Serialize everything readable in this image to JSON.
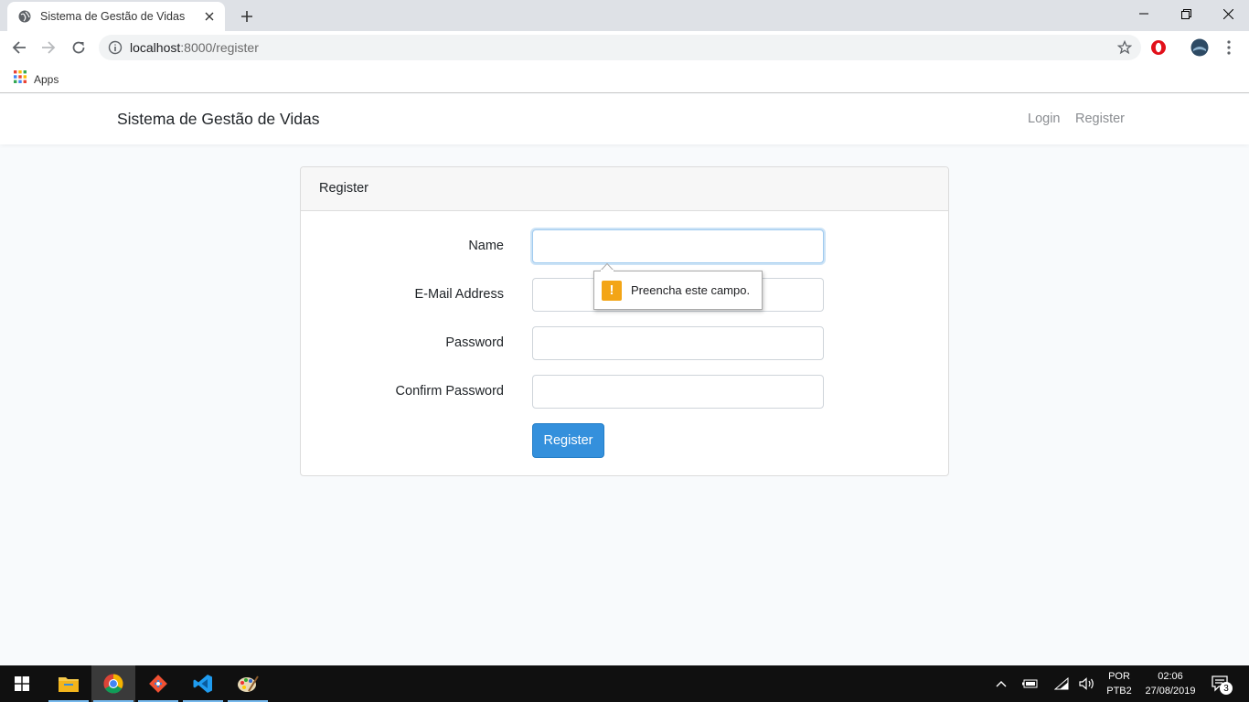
{
  "browser": {
    "tab_title": "Sistema de Gestão de Vidas",
    "url_host": "localhost",
    "url_path": ":8000/register",
    "bookmark_apps": "Apps"
  },
  "navbar": {
    "brand": "Sistema de Gestão de Vidas",
    "links": [
      "Login",
      "Register"
    ]
  },
  "card": {
    "header": "Register",
    "fields": [
      {
        "label": "Name",
        "value": ""
      },
      {
        "label": "E-Mail Address",
        "value": ""
      },
      {
        "label": "Password",
        "value": ""
      },
      {
        "label": "Confirm Password",
        "value": ""
      }
    ],
    "submit_label": "Register"
  },
  "validation_tooltip": {
    "icon": "warning-icon",
    "message": "Preencha este campo."
  },
  "taskbar": {
    "apps": [
      "file-explorer-icon",
      "chrome-icon",
      "git-icon",
      "vscode-icon",
      "paint-icon"
    ],
    "language_line1": "POR",
    "language_line2": "PTB2",
    "time": "02:06",
    "date": "27/08/2019",
    "notification_count": "3"
  },
  "colors": {
    "primary": "#3490dc",
    "warning": "#f3a516",
    "taskbar": "#101010",
    "page_bg": "#f8fafc"
  }
}
